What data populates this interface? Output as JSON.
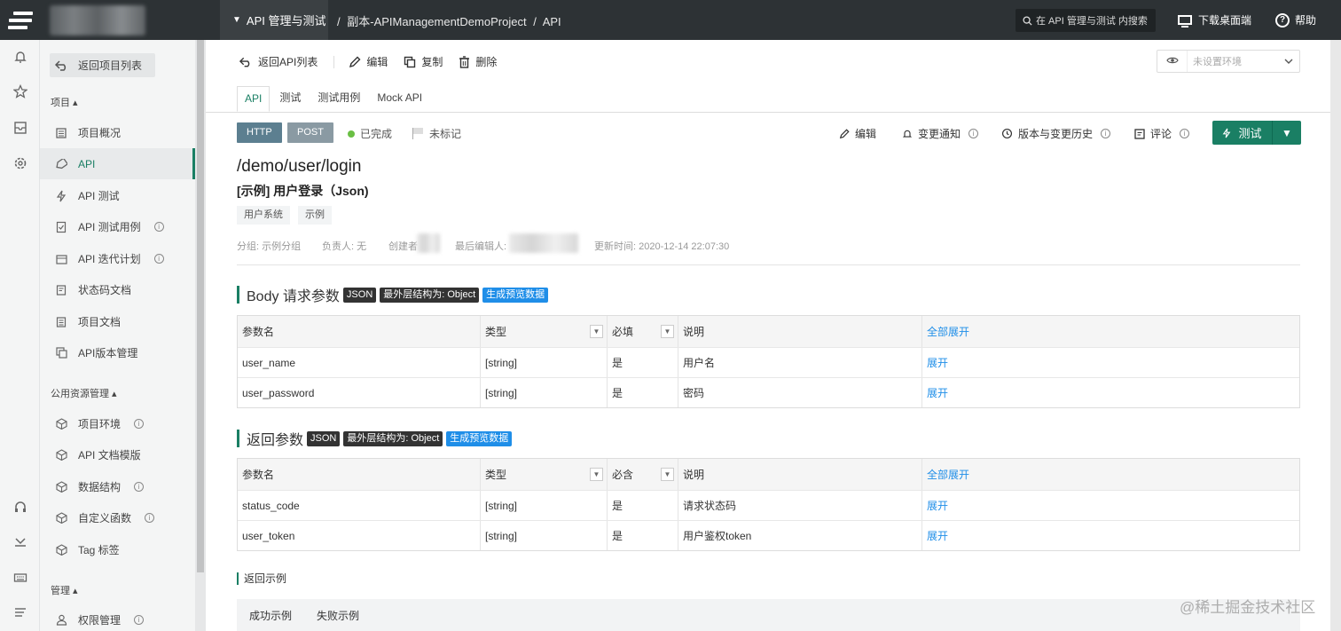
{
  "topbar": {
    "project_switch": "API 管理与测试",
    "breadcrumbs": [
      "/",
      "副本-APIManagementDemoProject",
      "/",
      "API"
    ],
    "search_placeholder": "在 API 管理与测试 内搜索",
    "download_label": "下载桌面端",
    "help_label": "帮助"
  },
  "sidebar": {
    "back_label": "返回项目列表",
    "sections": [
      {
        "title": "项目 ▴"
      },
      {
        "title": "公用资源管理 ▴"
      },
      {
        "title": "管理 ▴"
      }
    ],
    "items": [
      {
        "label": "项目概况",
        "icon": "dashboard-icon"
      },
      {
        "label": "API",
        "icon": "api-tag-icon"
      },
      {
        "label": "API 测试",
        "icon": "lightning-icon"
      },
      {
        "label": "API 测试用例",
        "icon": "checklist-icon"
      },
      {
        "label": "API 迭代计划",
        "icon": "calendar-icon"
      },
      {
        "label": "状态码文档",
        "icon": "document-icon"
      },
      {
        "label": "项目文档",
        "icon": "document-icon"
      },
      {
        "label": "API版本管理",
        "icon": "versions-icon"
      },
      {
        "label": "项目环境",
        "icon": "cube-icon"
      },
      {
        "label": "API 文档模版",
        "icon": "cube-icon"
      },
      {
        "label": "数据结构",
        "icon": "cube-icon"
      },
      {
        "label": "自定义函数",
        "icon": "cube-icon"
      },
      {
        "label": "Tag 标签",
        "icon": "cube-icon"
      },
      {
        "label": "权限管理",
        "icon": "user-icon"
      }
    ]
  },
  "toolbar": {
    "back_label": "返回API列表",
    "edit_label": "编辑",
    "copy_label": "复制",
    "delete_label": "删除",
    "env_placeholder": "未设置环境"
  },
  "tabs": [
    "API",
    "测试",
    "测试用例",
    "Mock API"
  ],
  "api": {
    "protocol": "HTTP",
    "method": "POST",
    "status": "已完成",
    "mark": "未标记",
    "path": "/demo/user/login",
    "name": "[示例] 用户登录（Json)",
    "tags": [
      "用户系统",
      "示例"
    ],
    "meta": {
      "group": "分组: 示例分组",
      "owner": "负责人: 无",
      "creator": "创建者",
      "last_editor": "最后编辑人:",
      "updated": "更新时间: 2020-12-14 22:07:30"
    },
    "actions": {
      "edit": "编辑",
      "notify": "变更通知",
      "history": "版本与变更历史",
      "comment": "评论",
      "test": "测试"
    }
  },
  "body_params": {
    "title": "Body 请求参数",
    "chip_format": "JSON",
    "chip_struct": "最外层结构为: Object",
    "chip_generate": "生成预览数据",
    "headers": [
      "参数名",
      "类型",
      "必填",
      "说明",
      "全部展开"
    ],
    "rows": [
      {
        "name": "user_name",
        "type": "[string]",
        "required": "是",
        "desc": "用户名",
        "expand": "展开"
      },
      {
        "name": "user_password",
        "type": "[string]",
        "required": "是",
        "desc": "密码",
        "expand": "展开"
      }
    ]
  },
  "return_params": {
    "title": "返回参数",
    "chip_format": "JSON",
    "chip_struct": "最外层结构为: Object",
    "chip_generate": "生成预览数据",
    "headers": [
      "参数名",
      "类型",
      "必含",
      "说明",
      "全部展开"
    ],
    "rows": [
      {
        "name": "status_code",
        "type": "[string]",
        "required": "是",
        "desc": "请求状态码",
        "expand": "展开"
      },
      {
        "name": "user_token",
        "type": "[string]",
        "required": "是",
        "desc": "用户鉴权token",
        "expand": "展开"
      }
    ]
  },
  "return_example": {
    "title": "返回示例",
    "tabs": [
      "成功示例",
      "失败示例"
    ]
  },
  "watermark": "@稀土掘金技术社区",
  "colors": {
    "accent": "#1a7f64",
    "topbar": "#2d3235",
    "link": "#1f8ee8"
  }
}
